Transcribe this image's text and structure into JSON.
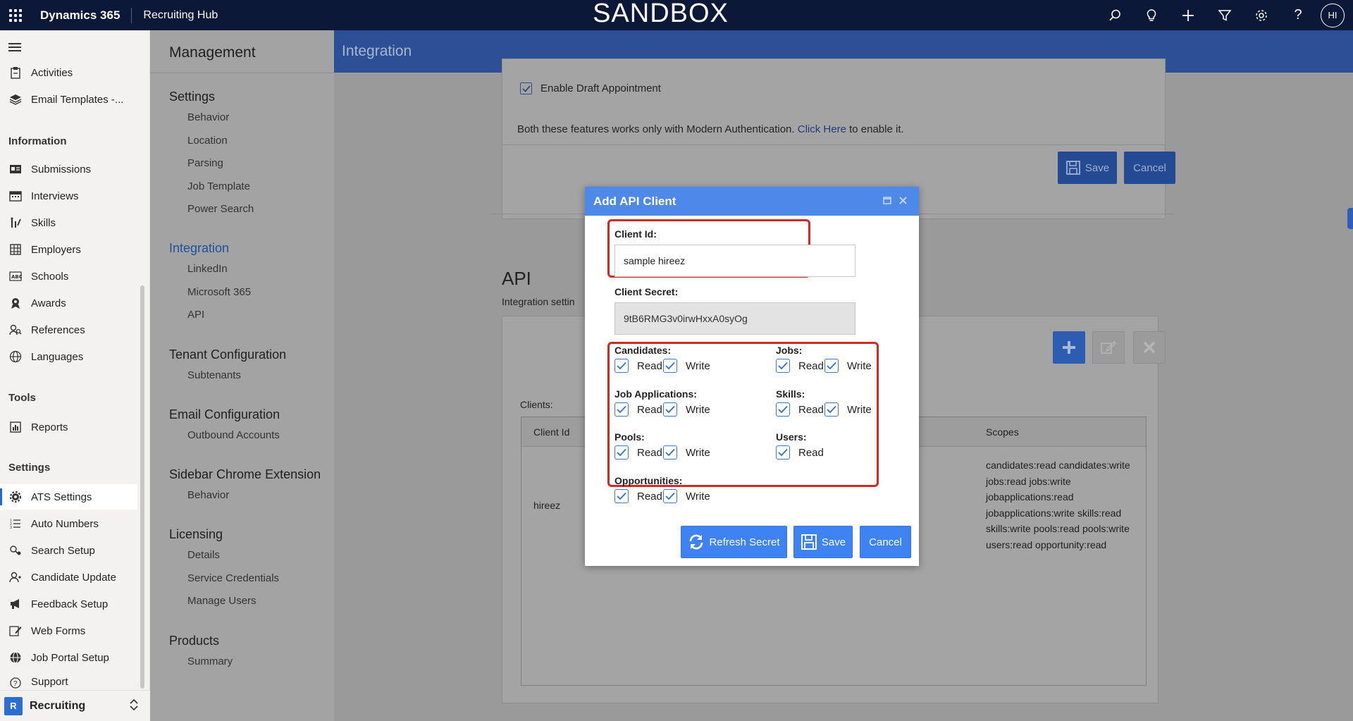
{
  "topbar": {
    "brand": "Dynamics 365",
    "app_name": "Recruiting Hub",
    "environment_banner": "SANDBOX",
    "avatar_initials": "HI",
    "icons": [
      "search-icon",
      "lightbulb-icon",
      "plus-icon",
      "filter-icon",
      "gear-icon",
      "help-icon"
    ]
  },
  "leftnav": {
    "items_top": [
      {
        "label": "Activities",
        "icon": "clipboard-icon"
      },
      {
        "label": "Email Templates -...",
        "icon": "layers-icon"
      }
    ],
    "section_information": "Information",
    "items_information": [
      {
        "label": "Submissions",
        "icon": "id-card-icon"
      },
      {
        "label": "Interviews",
        "icon": "calendar-icon"
      },
      {
        "label": "Skills",
        "icon": "skills-icon"
      },
      {
        "label": "Employers",
        "icon": "building-icon"
      },
      {
        "label": "Schools",
        "icon": "abc-icon"
      },
      {
        "label": "Awards",
        "icon": "award-icon"
      },
      {
        "label": "References",
        "icon": "person-search-icon"
      },
      {
        "label": "Languages",
        "icon": "globe-icon"
      }
    ],
    "section_tools": "Tools",
    "items_tools": [
      {
        "label": "Reports",
        "icon": "report-icon"
      }
    ],
    "section_settings": "Settings",
    "items_settings": [
      {
        "label": "ATS Settings",
        "icon": "gear-icon",
        "active": true
      },
      {
        "label": "Auto Numbers",
        "icon": "numbered-list-icon"
      },
      {
        "label": "Search Setup",
        "icon": "search-setup-icon"
      },
      {
        "label": "Candidate Update",
        "icon": "person-icon"
      },
      {
        "label": "Feedback Setup",
        "icon": "megaphone-icon"
      },
      {
        "label": "Web Forms",
        "icon": "edit-form-icon"
      },
      {
        "label": "Job Portal Setup",
        "icon": "globe-icon"
      },
      {
        "label": "Support",
        "icon": "help-icon"
      }
    ],
    "area_badge": "R",
    "area_label": "Recruiting"
  },
  "mgmt": {
    "title": "Management",
    "groups": [
      {
        "heading": "Settings",
        "items": [
          "Behavior",
          "Location",
          "Parsing",
          "Job Template",
          "Power Search"
        ]
      },
      {
        "heading": "Integration",
        "active": true,
        "items": [
          "LinkedIn",
          "Microsoft 365",
          "API"
        ]
      },
      {
        "heading": "Tenant Configuration",
        "items": [
          "Subtenants"
        ]
      },
      {
        "heading": "Email Configuration",
        "items": [
          "Outbound Accounts"
        ]
      },
      {
        "heading": "Sidebar Chrome Extension",
        "items": [
          "Behavior"
        ]
      },
      {
        "heading": "Licensing",
        "items": [
          "Details",
          "Service Credentials",
          "Manage Users"
        ]
      },
      {
        "heading": "Products",
        "items": [
          "Summary"
        ]
      }
    ]
  },
  "main": {
    "header_title": "Integration",
    "draft_label": "Enable Draft Appointment",
    "modern_auth_before": "Both these features works only with Modern Authentication.",
    "modern_auth_link": "Click Here",
    "modern_auth_after": "to enable it.",
    "save_label": "Save",
    "cancel_label": "Cancel",
    "api_title": "API",
    "api_subtitle": "Integration settin",
    "clients_label": "Clients:",
    "table_headers": {
      "client_id": "Client Id",
      "scopes": "Scopes"
    },
    "table_row": {
      "client_id": "hireez",
      "scopes": [
        "candidates:read candidates:write",
        "jobs:read jobs:write",
        "jobapplications:read",
        "jobapplications:write skills:read",
        "skills:write pools:read pools:write",
        "users:read opportunity:read"
      ]
    }
  },
  "dialog": {
    "title": "Add API Client",
    "client_id_label": "Client Id:",
    "client_id_value": "sample hireez",
    "client_secret_label": "Client Secret:",
    "client_secret_value": "9tB6RMG3v0irwHxxA0syOg",
    "read_label": "Read",
    "write_label": "Write",
    "permissions": {
      "candidates": "Candidates:",
      "jobs": "Jobs:",
      "job_applications": "Job Applications:",
      "skills": "Skills:",
      "pools": "Pools:",
      "users": "Users:",
      "opportunities": "Opportunities:"
    },
    "refresh_label": "Refresh Secret",
    "save_label": "Save",
    "cancel_label": "Cancel"
  }
}
